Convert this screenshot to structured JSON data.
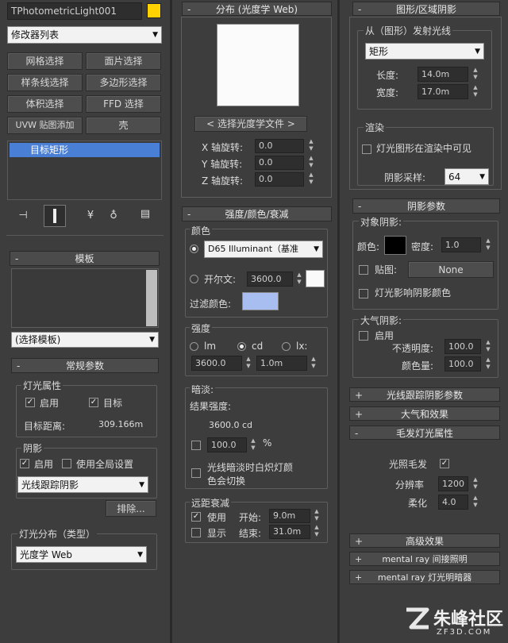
{
  "left": {
    "object_name": "TPhotometricLight001",
    "object_color": "#ffd200",
    "modifier_list": "修改器列表",
    "modifier_buttons": [
      "网格选择",
      "面片选择",
      "样条线选择",
      "多边形选择",
      "体积选择",
      "FFD 选择",
      "UVW 贴图添加",
      "壳"
    ],
    "stack_item": "目标矩形",
    "template_title": "模板",
    "template_select": "(选择模板)",
    "general_title": "常规参数",
    "light_props_group": "灯光属性",
    "enabled_label": "启用",
    "target_label": "目标",
    "target_distance_label": "目标距离:",
    "target_distance_value": "309.166m",
    "shadows_group": "阴影",
    "shadow_enabled_label": "启用",
    "global_settings_label": "使用全局设置",
    "shadow_type": "光线跟踪阴影",
    "exclude_button": "排除...",
    "distribution_group": "灯光分布（类型）",
    "distribution_type": "光度学 Web"
  },
  "middle": {
    "dist_title": "分布 (光度学 Web)",
    "choose_file_button": "< 选择光度学文件 >",
    "x_rot_label": "X 轴旋转:",
    "y_rot_label": "Y 轴旋转:",
    "z_rot_label": "Z 轴旋转:",
    "x_rot_value": "0.0",
    "y_rot_value": "0.0",
    "z_rot_value": "0.0",
    "intensity_title": "强度/颜色/衰减",
    "color_group": "颜色",
    "color_preset": "D65 Illuminant（基准",
    "kelvin_label": "开尔文:",
    "kelvin_value": "3600.0",
    "filter_color_label": "过滤颜色:",
    "filter_color": "#a8bdf0",
    "strength_group": "强度",
    "unit_lm": "lm",
    "unit_cd": "cd",
    "unit_lx": "lx:",
    "strength_value": "3600.0",
    "strength_dist": "1.0m",
    "dimming_group": "暗淡:",
    "result_label": "结果强度:",
    "result_value": "3600.0 cd",
    "dim_percent": "100.0",
    "percent_sign": "%",
    "incandescent_label_1": "光线暗淡时白炽灯颜",
    "incandescent_label_2": "色会切换",
    "far_atten_group": "远距衰减",
    "use_label": "使用",
    "show_label": "显示",
    "start_label": "开始:",
    "start_value": "9.0m",
    "end_label": "结束:",
    "end_value": "31.0m"
  },
  "right": {
    "shape_title": "图形/区域阴影",
    "emit_group": "从（图形）发射光线",
    "shape_type": "矩形",
    "length_label": "长度:",
    "length_value": "14.0m",
    "width_label": "宽度:",
    "width_value": "17.0m",
    "render_group": "渲染",
    "render_visible_label": "灯光图形在渲染中可见",
    "shadow_samples_label": "阴影采样:",
    "shadow_samples_value": "64",
    "shadow_params_title": "阴影参数",
    "object_shadows_group": "对象阴影:",
    "color_label": "颜色:",
    "density_label": "密度:",
    "density_value": "1.0",
    "map_label": "贴图:",
    "map_value": "None",
    "light_affects_label": "灯光影响阴影颜色",
    "atmo_shadows_group": "大气阴影:",
    "atmo_enable_label": "启用",
    "opacity_label": "不透明度:",
    "opacity_value": "100.0",
    "color_amount_label": "颜色量:",
    "color_amount_value": "100.0",
    "raytrace_title": "光线跟踪阴影参数",
    "atmosphere_title": "大气和效果",
    "hair_title": "毛发灯光属性",
    "light_hair_label": "光照毛发",
    "resolution_label": "分辨率",
    "resolution_value": "1200",
    "softness_label": "柔化",
    "softness_value": "4.0",
    "advanced_title": "高级效果",
    "mr_indirect_title": "mental ray 间接照明",
    "mr_shader_title": "mental ray 灯光明暗器"
  },
  "watermark": {
    "site": "朱峰社区",
    "domain": "ZF3D.COM"
  }
}
